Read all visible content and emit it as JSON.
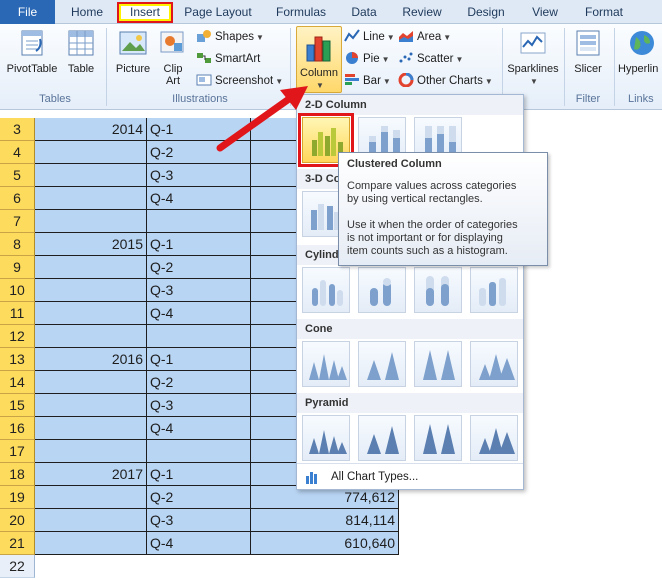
{
  "tabs": [
    "File",
    "Home",
    "Insert",
    "Page Layout",
    "Formulas",
    "Data",
    "Review",
    "Design",
    "View",
    "Format"
  ],
  "ribbon": {
    "tables": {
      "label": "Tables",
      "pivot": "PivotTable",
      "table": "Table"
    },
    "illustrations": {
      "label": "Illustrations",
      "picture": "Picture",
      "clipart_1": "Clip",
      "clipart_2": "Art",
      "shapes": "Shapes",
      "smartart": "SmartArt",
      "screenshot": "Screenshot"
    },
    "charts": {
      "column": "Column",
      "line": "Line",
      "pie": "Pie",
      "bar": "Bar",
      "area": "Area",
      "scatter": "Scatter",
      "other": "Other Charts"
    },
    "sparklines": {
      "label": "Sparklines"
    },
    "filter": {
      "label": "Filter",
      "slicer": "Slicer"
    },
    "links": {
      "label": "Links",
      "hyperlink": "Hyperlin"
    }
  },
  "rows": [
    {
      "n": "3",
      "a": "2014",
      "b": "Q-1",
      "c": ""
    },
    {
      "n": "4",
      "a": "",
      "b": "Q-2",
      "c": ""
    },
    {
      "n": "5",
      "a": "",
      "b": "Q-3",
      "c": ""
    },
    {
      "n": "6",
      "a": "",
      "b": "Q-4",
      "c": ""
    },
    {
      "n": "7",
      "a": "",
      "b": "",
      "c": ""
    },
    {
      "n": "8",
      "a": "2015",
      "b": "Q-1",
      "c": ""
    },
    {
      "n": "9",
      "a": "",
      "b": "Q-2",
      "c": ""
    },
    {
      "n": "10",
      "a": "",
      "b": "Q-3",
      "c": ""
    },
    {
      "n": "11",
      "a": "",
      "b": "Q-4",
      "c": ""
    },
    {
      "n": "12",
      "a": "",
      "b": "",
      "c": ""
    },
    {
      "n": "13",
      "a": "2016",
      "b": "Q-1",
      "c": ""
    },
    {
      "n": "14",
      "a": "",
      "b": "Q-2",
      "c": ""
    },
    {
      "n": "15",
      "a": "",
      "b": "Q-3",
      "c": ""
    },
    {
      "n": "16",
      "a": "",
      "b": "Q-4",
      "c": ""
    },
    {
      "n": "17",
      "a": "",
      "b": "",
      "c": ""
    },
    {
      "n": "18",
      "a": "2017",
      "b": "Q-1",
      "c": ""
    },
    {
      "n": "19",
      "a": "",
      "b": "Q-2",
      "c": "774,612"
    },
    {
      "n": "20",
      "a": "",
      "b": "Q-3",
      "c": "814,114"
    },
    {
      "n": "21",
      "a": "",
      "b": "Q-4",
      "c": "610,640"
    }
  ],
  "extra_row": "22",
  "dropdown": {
    "section_2d": "2-D Column",
    "section_3d": "3-D Co",
    "section_cyl": "Cylind",
    "section_cone": "Cone",
    "section_pyramid": "Pyramid",
    "all_types": "All Chart Types..."
  },
  "tooltip": {
    "title": "Clustered Column",
    "line1": "Compare values across categories",
    "line2": "by using vertical rectangles.",
    "line3": "Use it when the order of categories",
    "line4": "is not important or for displaying",
    "line5": "item counts such as a histogram."
  },
  "colors": {
    "accent": "#2a67b4",
    "highlight": "#e0161b",
    "selection": "#b8d5f3",
    "rowheader": "#fddb5d"
  }
}
